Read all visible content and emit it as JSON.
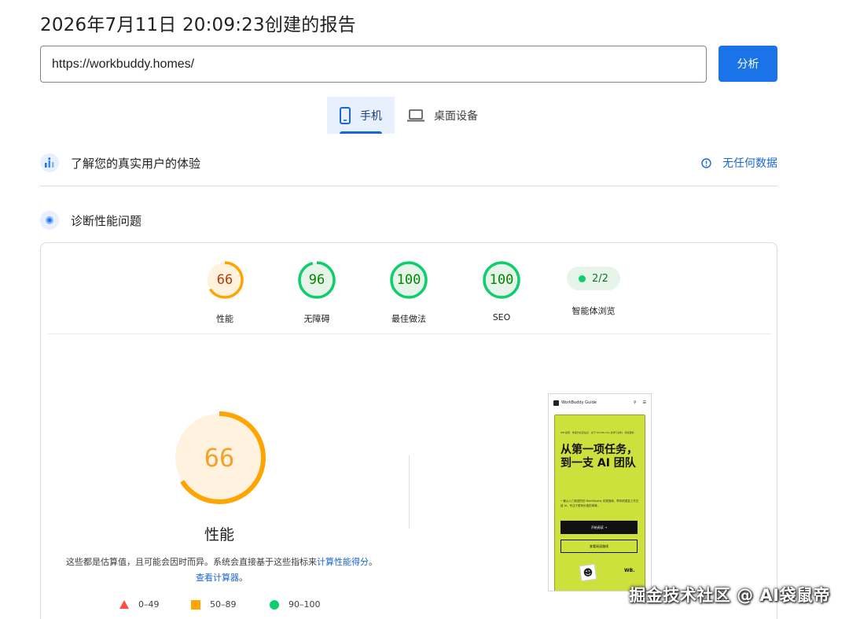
{
  "header": {
    "title": "2026年7月11日 20:09:23创建的报告"
  },
  "url_bar": {
    "value": "https://workbuddy.homes/",
    "analyze_label": "分析"
  },
  "device_tabs": [
    {
      "label": "手机",
      "icon": "smartphone-icon",
      "active": true
    },
    {
      "label": "桌面设备",
      "icon": "laptop-icon",
      "active": false
    }
  ],
  "field_data": {
    "title": "了解您的真实用户的体验",
    "no_data_label": "无任何数据"
  },
  "diagnose": {
    "title": "诊断性能问题"
  },
  "scores": [
    {
      "label": "性能",
      "value": "66",
      "score": 66,
      "color": "#ffa400"
    },
    {
      "label": "无障碍",
      "value": "96",
      "score": 96,
      "color": "#0cce6b"
    },
    {
      "label": "最佳做法",
      "value": "100",
      "score": 100,
      "color": "#0cce6b"
    },
    {
      "label": "SEO",
      "value": "100",
      "score": 100,
      "color": "#0cce6b"
    }
  ],
  "agent_browsing": {
    "label": "智能体浏览",
    "value": "2/2"
  },
  "performance": {
    "score": 66,
    "value": "66",
    "title": "性能",
    "desc_text": "这些都是估算值，且可能会因时而异。系统会直接基于这些指标来",
    "desc_link1": "计算性能得分",
    "desc_sep": "。",
    "desc_link2": "查看计算器",
    "desc_end": "。"
  },
  "legend": [
    {
      "label": "0–49",
      "shape": "triangle",
      "color": "#ff4e42"
    },
    {
      "label": "50–89",
      "shape": "square",
      "color": "#ffa400"
    },
    {
      "label": "90–100",
      "shape": "circle",
      "color": "#0cce6b"
    }
  ],
  "screenshot": {
    "site_name": "WorkBuddy Guide",
    "tiny_line": "WB 指南 · 非官方社区站点 · 关于 WorkBuddy 的学习资料 · 持续更新",
    "headline": "从第一项任务，到一支 AI 团队",
    "paragraph": "一套从入门到进阶的 WorkBuddy 实践指南，帮你把重复工作交给 AI，专注于更有价值的事情。",
    "button_primary": "开始阅读 →",
    "button_secondary": "查看阅读路线",
    "corner_text": "WB."
  },
  "watermark": "掘金技术社区 @ AI袋鼠帝"
}
